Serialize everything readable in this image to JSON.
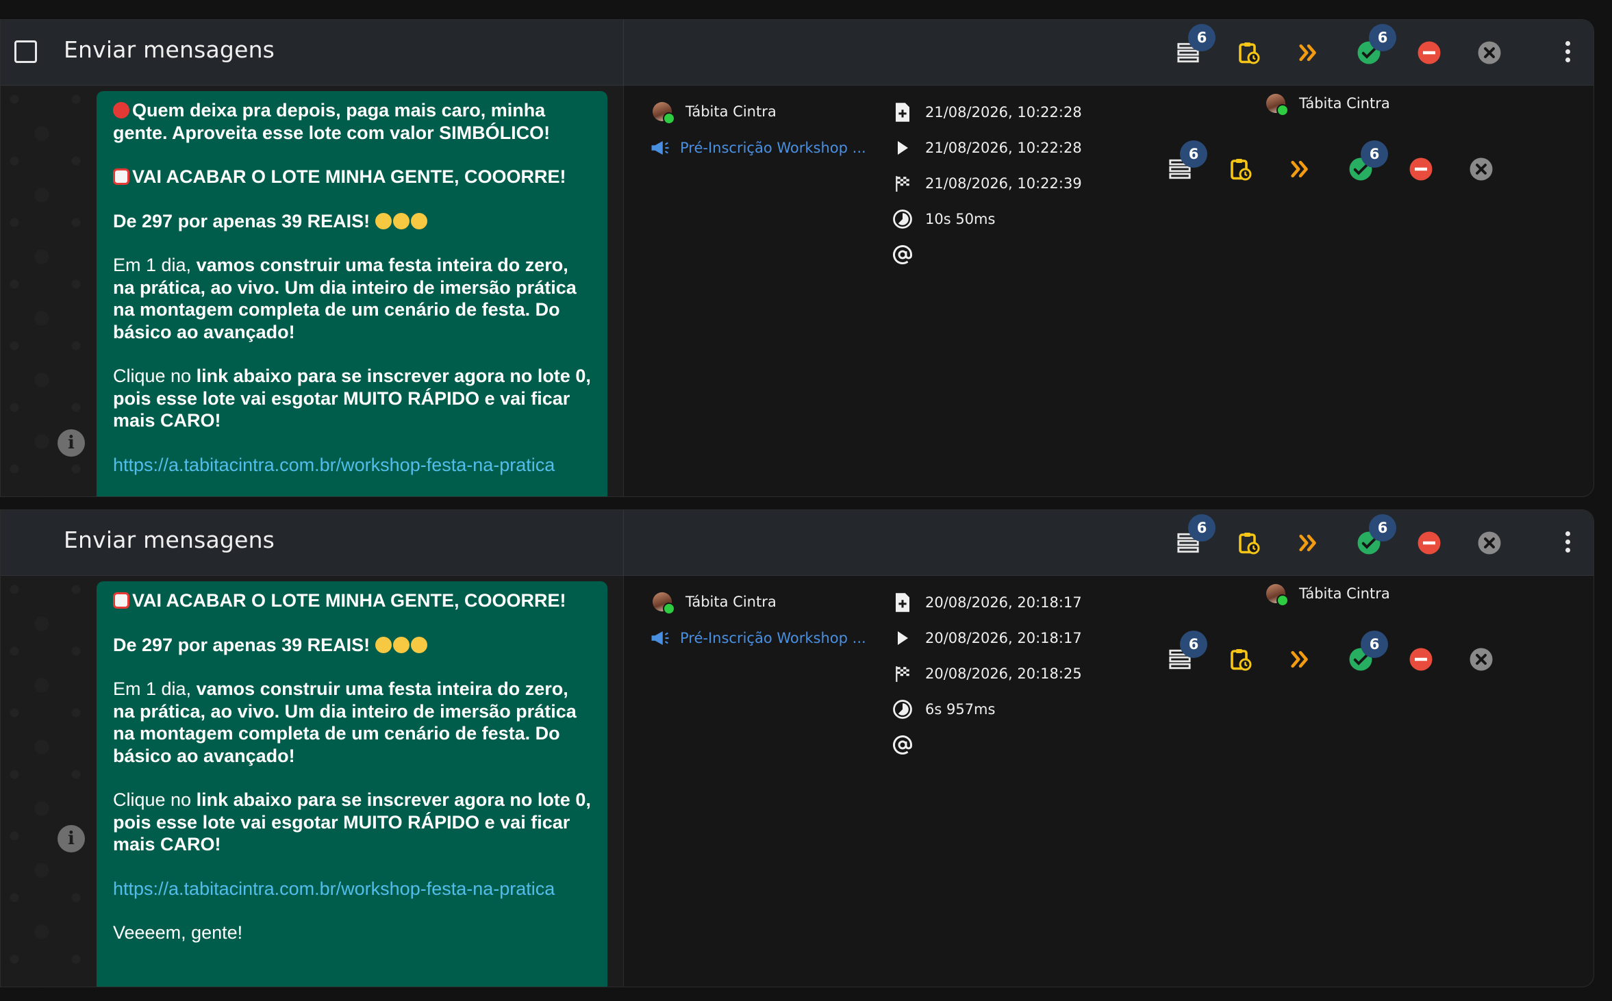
{
  "cards": [
    {
      "title": "Enviar mensagens",
      "toolbar": {
        "queue_count": "6",
        "success_count": "6"
      },
      "contact_name": "Tábita Cintra",
      "campaign": "Pré-Inscrição Workshop ...",
      "created": "21/08/2026, 10:22:28",
      "started": "21/08/2026, 10:22:28",
      "finished": "21/08/2026, 10:22:39",
      "duration": "10s 50ms",
      "assignee": "Tábita Cintra",
      "status_counts": {
        "queue": "6",
        "success": "6"
      },
      "message": {
        "line1": "Quem deixa pra depois, paga mais caro, minha gente. Aproveita esse lote com valor SIMBÓLICO!",
        "line2": "VAI ACABAR O LOTE MINHA GENTE, COOORRE!",
        "line3": "De 297 por apenas 39 REAIS!",
        "line4_plain": "Em 1 dia, ",
        "line4_bold": "vamos construir uma festa inteira do zero, na prática, ao vivo. Um dia inteiro de imersão prática na montagem completa de um cenário de festa. Do básico ao avançado!",
        "line5_plain": "Clique no ",
        "line5_bold": "link abaixo para se inscrever agora no lote 0, pois esse lote vai esgotar MUITO RÁPIDO e vai ficar mais CARO!",
        "link": "https://a.tabitacintra.com.br/workshop-festa-na-pratica"
      }
    },
    {
      "title": "Enviar mensagens",
      "toolbar": {
        "queue_count": "6",
        "success_count": "6"
      },
      "contact_name": "Tábita Cintra",
      "campaign": "Pré-Inscrição Workshop ...",
      "created": "20/08/2026, 20:18:17",
      "started": "20/08/2026, 20:18:17",
      "finished": "20/08/2026, 20:18:25",
      "duration": "6s 957ms",
      "assignee": "Tábita Cintra",
      "status_counts": {
        "queue": "6",
        "success": "6"
      },
      "message": {
        "line2": "VAI ACABAR O LOTE MINHA GENTE, COOORRE!",
        "line3": "De 297 por apenas 39 REAIS!",
        "line4_plain": "Em 1 dia, ",
        "line4_bold": "vamos construir uma festa inteira do zero, na prática, ao vivo. Um dia inteiro de imersão prática na montagem completa de um cenário de festa. Do básico ao avançado!",
        "line5_plain": "Clique no ",
        "line5_bold": "link abaixo para se inscrever agora no lote 0, pois esse lote vai esgotar MUITO RÁPIDO e vai ficar mais CARO!",
        "link": "https://a.tabitacintra.com.br/workshop-festa-na-pratica",
        "line6": "Veeeem, gente!"
      }
    }
  ],
  "icons": {
    "queue": "queue-icon",
    "scheduled": "scheduled-clipboard-icon",
    "skip": "double-chevron-icon",
    "success": "check-circle-icon",
    "blocked": "minus-circle-icon",
    "cancel": "x-circle-icon",
    "more": "more-vertical-icon",
    "created": "file-plus-icon",
    "started": "play-icon",
    "finished": "checkered-flag-icon",
    "duration": "timer-icon",
    "mention": "at-sign-icon",
    "campaign": "megaphone-icon",
    "info": "info-icon"
  },
  "colors": {
    "bubble": "#005c4b",
    "link": "#53bdeb",
    "badge": "#2a4a78",
    "yellow": "#f5c518",
    "orange": "#f39c12",
    "green": "#27ae60",
    "red": "#e74c3c",
    "gray": "#8a8a8a"
  }
}
